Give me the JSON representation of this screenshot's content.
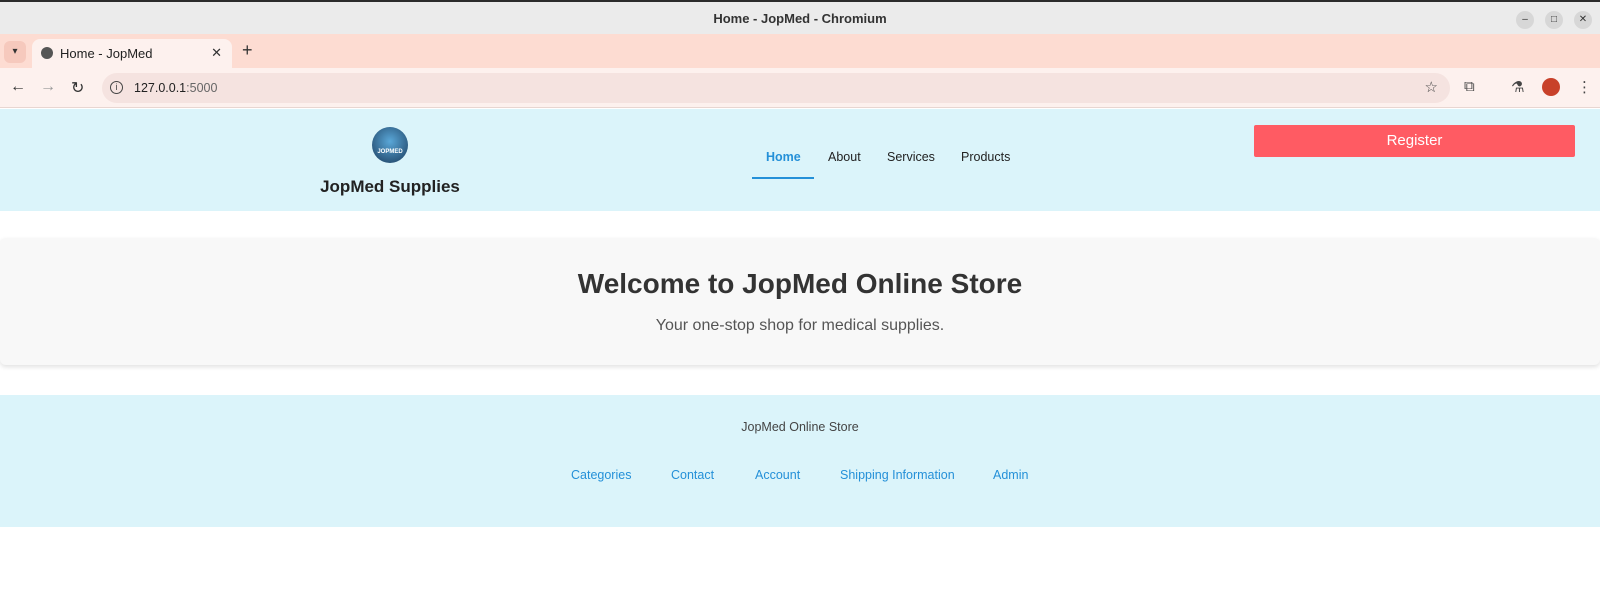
{
  "browser": {
    "window_title": "Home - JopMed - Chromium",
    "tab_title": "Home - JopMed",
    "url_host": "127.0.0.1",
    "url_port": ":5000",
    "icons": [
      "tab-search-icon",
      "globe-icon",
      "close-icon",
      "new-tab-icon",
      "back-icon",
      "forward-icon",
      "reload-icon",
      "site-info-icon",
      "bookmark-star-icon",
      "extensions-icon",
      "labs-icon",
      "profile-icon",
      "menu-icon",
      "minimize-icon",
      "maximize-icon",
      "window-close-icon"
    ]
  },
  "header": {
    "logo_text": "JOPMED",
    "brand": "JopMed Supplies",
    "nav": [
      "Home",
      "About",
      "Services",
      "Products"
    ],
    "active_nav": "Home",
    "register_label": "Register"
  },
  "hero": {
    "title": "Welcome to JopMed Online Store",
    "subtitle": "Your one-stop shop for medical supplies."
  },
  "footer": {
    "title": "JopMed Online Store",
    "links": [
      "Categories",
      "Contact",
      "Account",
      "Shipping Information",
      "Admin"
    ]
  },
  "colors": {
    "header_bg": "#dbf4fa",
    "accent": "#2490d8",
    "register_bg": "#ff5b63",
    "hero_bg": "#f8f8f8"
  }
}
